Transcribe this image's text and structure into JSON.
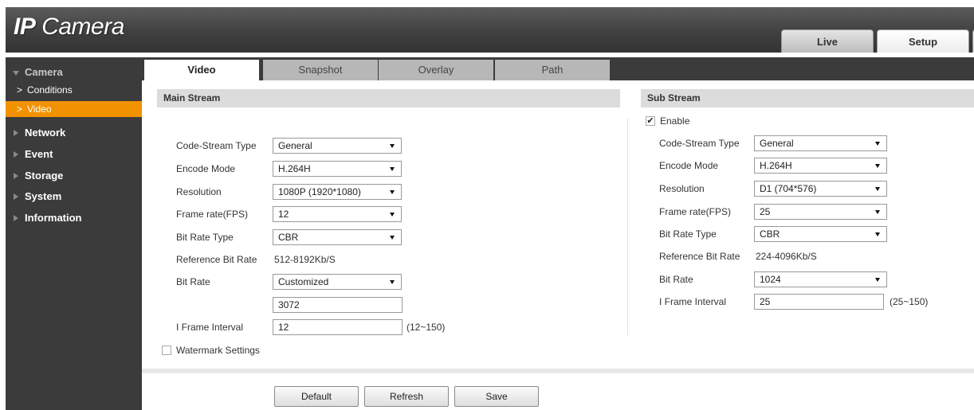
{
  "app": {
    "logo_prefix": "IP",
    "logo_suffix": " Camera"
  },
  "top_tabs": {
    "live": "Live",
    "setup": "Setup"
  },
  "sidebar": {
    "camera": "Camera",
    "conditions": "Conditions",
    "video": "Video",
    "network": "Network",
    "event": "Event",
    "storage": "Storage",
    "system": "System",
    "information": "Information"
  },
  "tabs": [
    "Video",
    "Snapshot",
    "Overlay",
    "Path"
  ],
  "main_stream": {
    "title": "Main Stream",
    "labels": {
      "code_stream_type": "Code-Stream Type",
      "encode_mode": "Encode Mode",
      "resolution": "Resolution",
      "frame_rate": "Frame rate(FPS)",
      "bit_rate_type": "Bit Rate Type",
      "reference_bit_rate": "Reference Bit Rate",
      "bit_rate": "Bit Rate",
      "i_frame_interval": "I Frame Interval"
    },
    "values": {
      "code_stream_type": "General",
      "encode_mode": "H.264H",
      "resolution": "1080P (1920*1080)",
      "frame_rate": "12",
      "bit_rate_type": "CBR",
      "reference_bit_rate": "512-8192Kb/S",
      "bit_rate": "Customized",
      "bit_rate_custom": "3072",
      "i_frame_interval": "12",
      "i_frame_range": "(12~150)"
    },
    "watermark_label": "Watermark Settings",
    "watermark_checked": false
  },
  "sub_stream": {
    "title": "Sub Stream",
    "enable_label": "Enable",
    "enable_checked": true,
    "labels": {
      "code_stream_type": "Code-Stream Type",
      "encode_mode": "Encode Mode",
      "resolution": "Resolution",
      "frame_rate": "Frame rate(FPS)",
      "bit_rate_type": "Bit Rate Type",
      "reference_bit_rate": "Reference Bit Rate",
      "bit_rate": "Bit Rate",
      "i_frame_interval": "I Frame Interval"
    },
    "values": {
      "code_stream_type": "General",
      "encode_mode": "H.264H",
      "resolution": "D1 (704*576)",
      "frame_rate": "25",
      "bit_rate_type": "CBR",
      "reference_bit_rate": "224-4096Kb/S",
      "bit_rate": "1024",
      "i_frame_interval": "25",
      "i_frame_range": "(25~150)"
    }
  },
  "buttons": {
    "default": "Default",
    "refresh": "Refresh",
    "save": "Save"
  },
  "colors": {
    "accent": "#f39200",
    "sidebar_bg": "#3b3b3b",
    "header_bg": "#404040"
  }
}
